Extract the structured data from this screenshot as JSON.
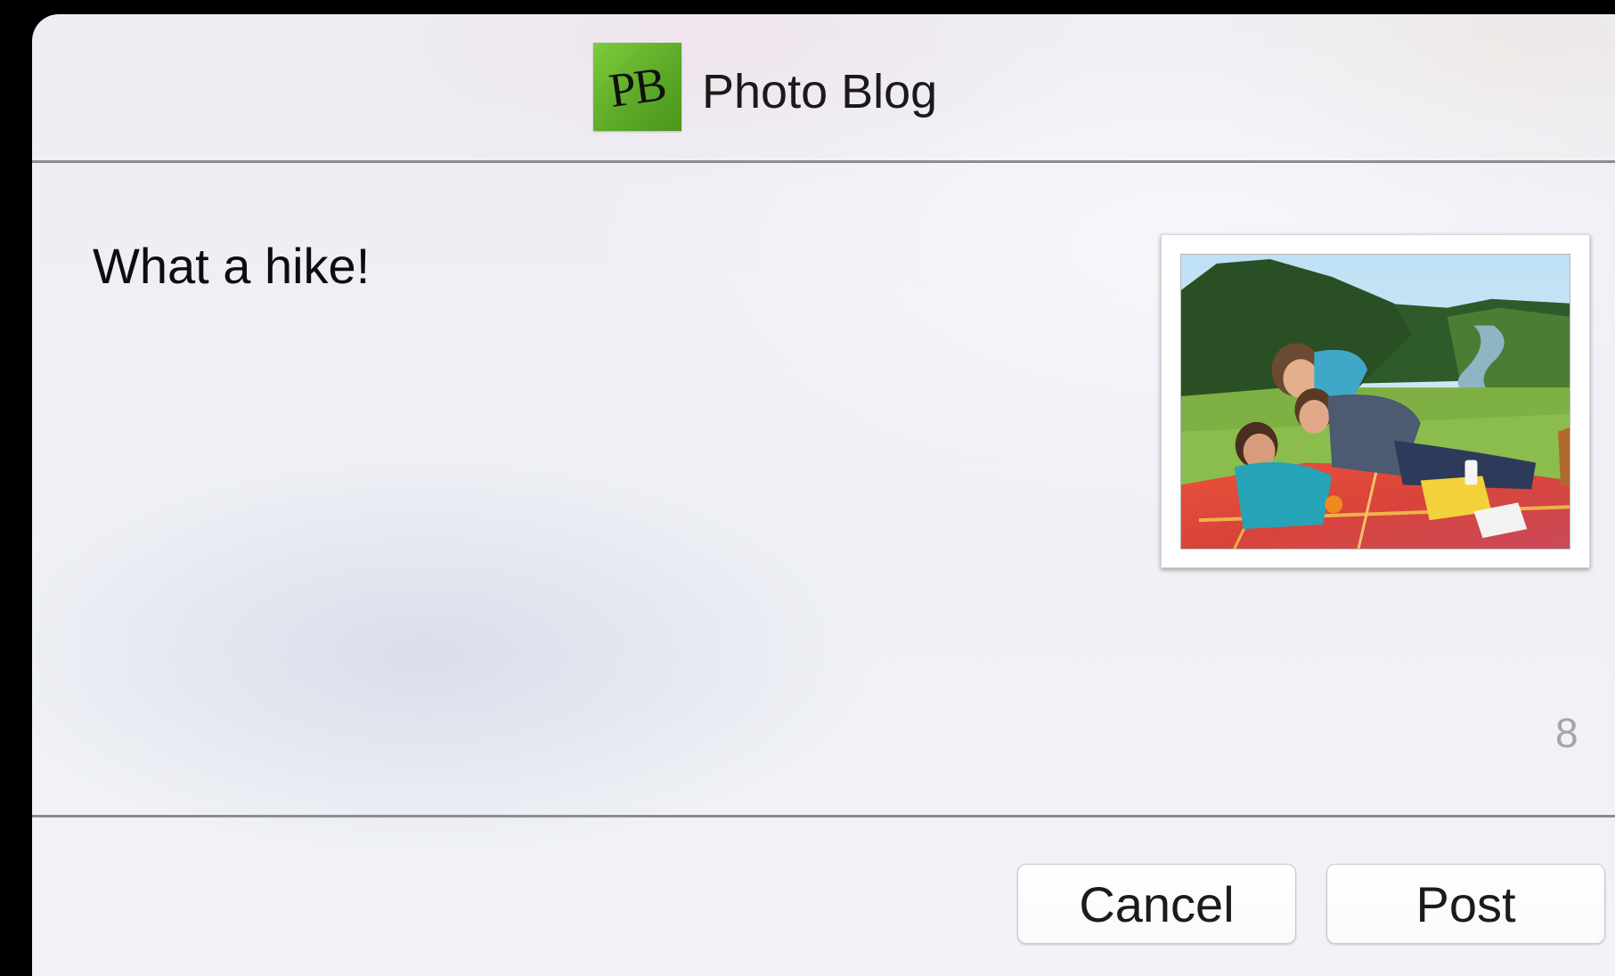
{
  "app": {
    "logo_text": "PB",
    "title": "Photo Blog"
  },
  "compose": {
    "message": "What a hike!",
    "characters_remaining": "8",
    "attachment_icon": "photo-attachment"
  },
  "actions": {
    "cancel_label": "Cancel",
    "post_label": "Post"
  },
  "colors": {
    "logo_green": "#5daa28",
    "divider": "#8a8c92",
    "counter_gray": "#a3a5aa"
  }
}
